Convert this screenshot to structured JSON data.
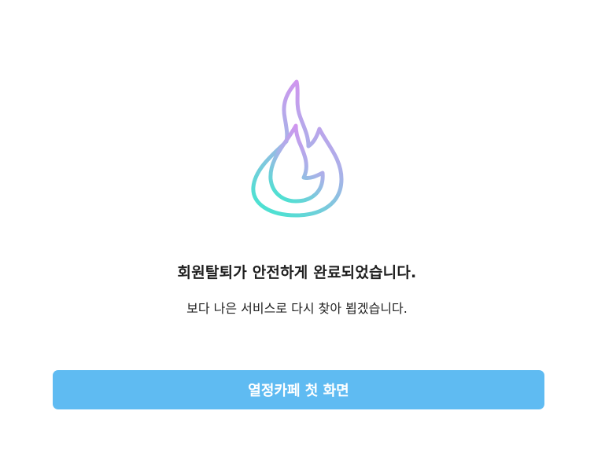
{
  "message": {
    "title": "회원탈퇴가 안전하게 완료되었습니다.",
    "subtitle": "보다 나은 서비스로 다시 찾아 뵙겠습니다."
  },
  "actions": {
    "home_button_label": "열정카페 첫 화면"
  },
  "icon": {
    "name": "flame-icon",
    "gradient_colors": [
      "#d98ef0",
      "#9fb8e6",
      "#55e0d4"
    ]
  },
  "colors": {
    "button_bg": "#5fbbf2",
    "button_text": "#ffffff",
    "title_text": "#1f1f1f",
    "background": "#ffffff"
  }
}
